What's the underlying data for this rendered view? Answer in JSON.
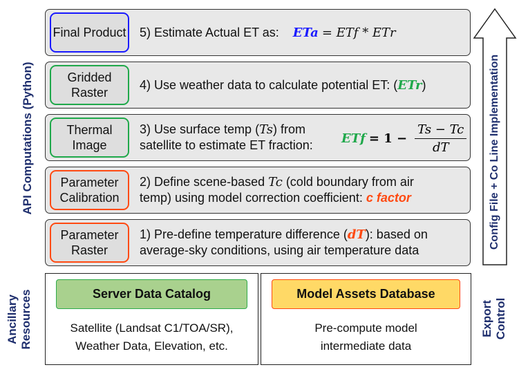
{
  "side_labels": {
    "api": "API Computations (Python)",
    "ancillary": "Ancillary\nResources",
    "export": "Export\nControl",
    "arrow": "Config File + Co Line Implementation"
  },
  "steps": [
    {
      "tag": "Final Product",
      "text": "5)  Estimate Actual ET as:",
      "formula_lhs": "ETa",
      "formula_rhs": "= ETf * ETr",
      "color": "#1a1aff"
    },
    {
      "tag": "Gridded Raster",
      "text": "4)  Use weather data to calculate potential ET: (",
      "formula": "ETr",
      "text_end": ")",
      "color": "#1fa84a"
    },
    {
      "tag": "Thermal Image",
      "text_a": "3)  Use surface temp (",
      "var": "Ts",
      "text_b": ") from",
      "text_c": "satellite to estimate ET fraction:",
      "formula_lhs": "ETf",
      "formula_mid": "= 1 −",
      "numerator": "Ts − Tc",
      "denominator": "dT",
      "color": "#1fa84a"
    },
    {
      "tag": "Parameter Calibration",
      "text_a": "2)  Define scene-based ",
      "var": "Tc",
      "text_b": " (cold boundary from air",
      "text_c": "temp) using model correction coefficient: ",
      "highlight": "c factor",
      "color": "#ff4a12"
    },
    {
      "tag": "Parameter Raster",
      "text_a": "1)  Pre-define temperature difference (",
      "var": "dT",
      "text_b": "): based on",
      "text_c": "average-sky conditions, using air temperature data",
      "color": "#ff4a12"
    }
  ],
  "resources": [
    {
      "title": "Server Data Catalog",
      "line1": "Satellite (Landsat C1/TOA/SR),",
      "line2": "Weather Data, Elevation, etc.",
      "fill": "#a9d18e",
      "border": "#2eaa4a"
    },
    {
      "title": "Model Assets Database",
      "line1": "Pre-compute model",
      "line2": "intermediate data",
      "fill": "#ffd966",
      "border": "#ff4a12"
    }
  ]
}
